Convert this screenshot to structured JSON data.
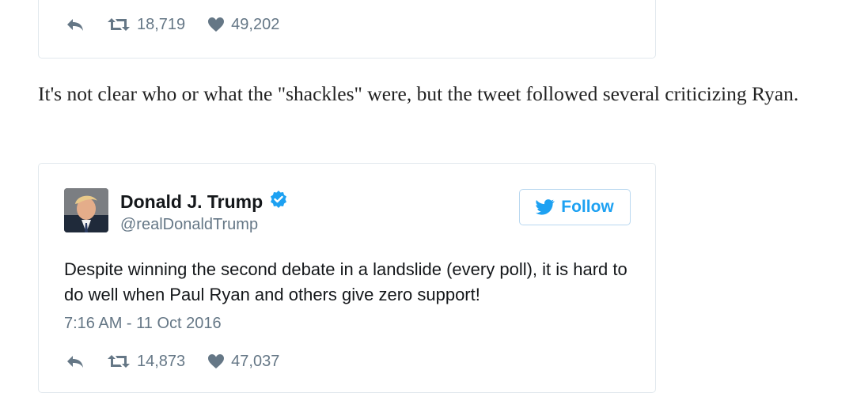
{
  "top_tweet": {
    "retweets": "18,719",
    "likes": "49,202"
  },
  "article": {
    "paragraph": "It's not clear who or what the \"shackles\" were, but the tweet followed several criticizing Ryan."
  },
  "tweet": {
    "author_name": "Donald J. Trump",
    "handle": "@realDonaldTrump",
    "follow_label": "Follow",
    "text": "Despite winning the second debate in a landslide (every poll), it is hard to do well when Paul Ryan and others give zero support!",
    "timestamp": "7:16 AM - 11 Oct 2016",
    "retweets": "14,873",
    "likes": "47,037"
  },
  "icons": {
    "reply": "reply-icon",
    "retweet": "retweet-icon",
    "like": "heart-icon",
    "verified": "verified-badge-icon",
    "twitter": "twitter-bird-icon"
  },
  "colors": {
    "twitter_blue": "#1da1f2",
    "meta_gray": "#657786",
    "border": "#e1e8ed"
  }
}
